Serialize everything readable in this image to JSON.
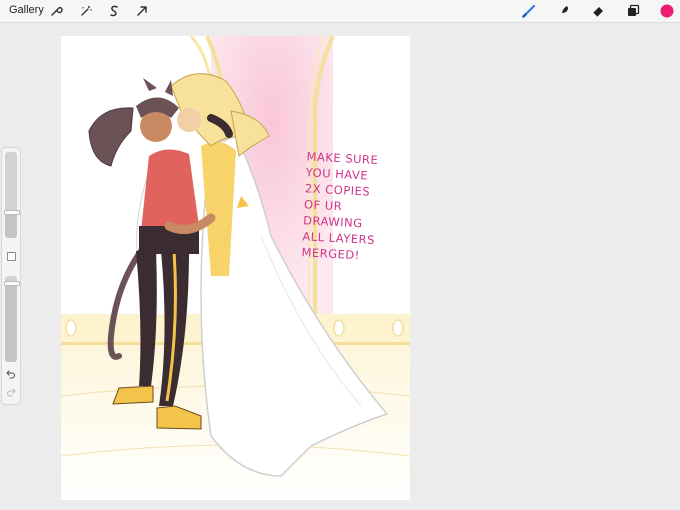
{
  "toolbar": {
    "gallery_label": "Gallery",
    "left_tools": [
      "wrench-icon",
      "magic-wand-icon",
      "selection-icon",
      "transform-arrow-icon"
    ],
    "right_tools": [
      "brush-icon",
      "smudge-icon",
      "eraser-icon",
      "layers-icon",
      "color-swatch"
    ],
    "active_color": "#ee1c73",
    "brush_active_color": "#2f7fe0"
  },
  "sidebar": {
    "size_slider_level": 0.3,
    "opacity_slider_level": 0.92,
    "buttons": [
      "modify-square",
      "undo-icon",
      "redo-icon"
    ]
  },
  "canvas": {
    "handwritten_note": [
      "MAKE SURE",
      "YOU HAVE",
      "2X COPIES",
      "OF UR",
      "DRAWING",
      "ALL LAYERS",
      "MERGED!"
    ],
    "note_color": "#d0338a"
  }
}
